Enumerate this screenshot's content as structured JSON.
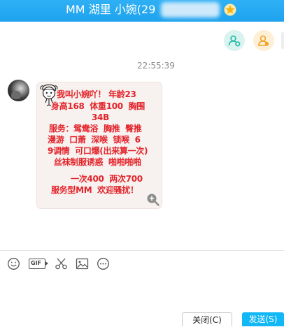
{
  "window": {
    "title": "MM 湖里 小婉(29",
    "title_icons": [
      "star-badge-icon"
    ]
  },
  "header_actions": {
    "icons": [
      "add-friend-icon",
      "contact-icon"
    ]
  },
  "chat": {
    "timestamp": "22:55:39",
    "message": {
      "lines": [
        "我叫小婉吖！ 年龄23",
        "身高168  体重100  胸围",
        "34B",
        "服务：鸳鸯浴  胸推  臀推",
        "漫游  口萧  深喉  锁喉  6",
        "9调情  可口爆(出来算一次)",
        "丝袜制服诱惑  啪啪啪啪",
        "一次400  两次700",
        "服务型MM  欢迎骚扰！"
      ],
      "icons": [
        "doodle-girl-icon",
        "zoom-in-icon"
      ]
    }
  },
  "toolbar": {
    "gif_label": "GIF",
    "icons": [
      "emoji-icon",
      "gif-icon",
      "scissors-icon",
      "image-icon",
      "more-icon"
    ]
  },
  "footer": {
    "close_label": "关闭(C)",
    "send_label": "发送(S)"
  },
  "colors": {
    "title_bar": "#22a6ee",
    "message_text": "#e3242b",
    "send_button": "#12b7f5",
    "add_friend_icon": "#2bb9a8",
    "contact_icon": "#f0a227"
  }
}
